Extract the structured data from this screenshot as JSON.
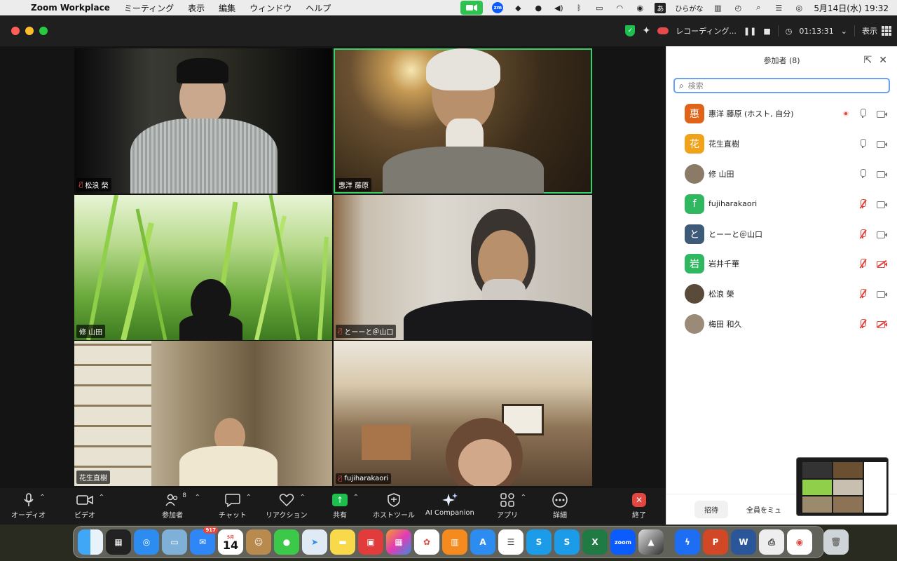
{
  "menubar": {
    "app_name": "Zoom Workplace",
    "menus": [
      "ミーティング",
      "表示",
      "編集",
      "ウィンドウ",
      "ヘルプ"
    ],
    "ime_label": "あ",
    "ime_name": "ひらがな",
    "zm_label": "zm",
    "datetime": "5月14日(水)  19:32"
  },
  "titlebar": {
    "recording_label": "レコーディング...",
    "timer": "01:13:31",
    "view_label": "表示"
  },
  "gallery": {
    "tiles": [
      {
        "name": "松浪 榮",
        "muted": true
      },
      {
        "name": "惠洋 藤原",
        "muted": false,
        "active": true
      },
      {
        "name": "修 山田",
        "muted": false
      },
      {
        "name": "とーーと＠山口",
        "muted": true
      },
      {
        "name": "花生直樹",
        "muted": false
      },
      {
        "name": "fujiharakaori",
        "muted": true
      }
    ]
  },
  "panel": {
    "title": "参加者 (8)",
    "search_placeholder": "検索",
    "participants": [
      {
        "avatar": "惠",
        "color": "#e0631a",
        "name": "惠洋 藤原 (ホスト, 自分)",
        "mic_muted": false,
        "cam_off": false,
        "recording": true
      },
      {
        "avatar": "花",
        "color": "#f0a21a",
        "name": "花生直樹",
        "mic_muted": false,
        "cam_off": false,
        "recording": false
      },
      {
        "avatar": "",
        "color": "#8a7a66",
        "name": "修 山田",
        "mic_muted": false,
        "cam_off": false,
        "recording": false
      },
      {
        "avatar": "f",
        "color": "#2fb860",
        "name": "fujiharakaori",
        "mic_muted": true,
        "cam_off": false,
        "recording": false
      },
      {
        "avatar": "と",
        "color": "#3d5a78",
        "name": "とーーと＠山口",
        "mic_muted": true,
        "cam_off": false,
        "recording": false
      },
      {
        "avatar": "岩",
        "color": "#2fb860",
        "name": "岩井千華",
        "mic_muted": true,
        "cam_off": true,
        "recording": false
      },
      {
        "avatar": "",
        "color": "#5a4a3a",
        "name": "松浪 榮",
        "mic_muted": true,
        "cam_off": false,
        "recording": false
      },
      {
        "avatar": "",
        "color": "#9a8a78",
        "name": "梅田 和久",
        "mic_muted": true,
        "cam_off": true,
        "recording": false
      }
    ],
    "invite_label": "招待",
    "mute_all_label": "全員をミュ"
  },
  "toolbar": {
    "audio": "オーディオ",
    "video": "ビデオ",
    "participants": "参加者",
    "participants_count": "8",
    "chat": "チャット",
    "reactions": "リアクション",
    "share": "共有",
    "host_tools": "ホストツール",
    "ai_companion": "AI Companion",
    "apps": "アプリ",
    "more": "詳細",
    "end": "終了"
  },
  "dock": {
    "mail_badge": "917",
    "calendar_month": "5月",
    "calendar_day": "14",
    "zoom_label": "zoom"
  }
}
